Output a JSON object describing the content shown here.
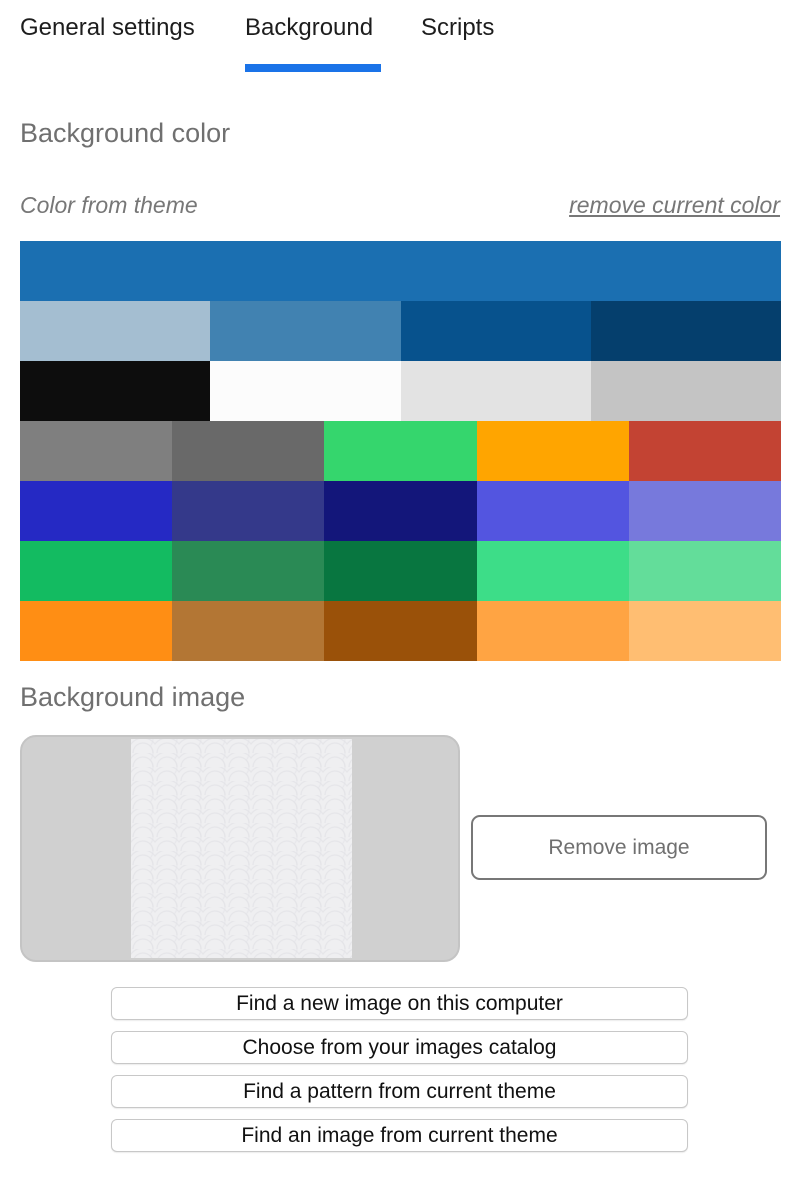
{
  "tabs": [
    {
      "label": "General settings"
    },
    {
      "label": "Background"
    },
    {
      "label": "Scripts"
    }
  ],
  "active_tab": "Background",
  "accent_color": "#1a73e8",
  "background_color": {
    "heading": "Background color",
    "theme_label": "Color from theme",
    "remove_link": "remove current color",
    "palette_rows": [
      [
        "#1b6fb1"
      ],
      [
        "#a4bed1",
        "#4182b1",
        "#07528d",
        "#053f6d"
      ],
      [
        "#0d0d0d",
        "#fcfcfc",
        "#e3e3e3",
        "#c4c4c4"
      ],
      [
        "#7f7f7f",
        "#696969",
        "#35d66d",
        "#ffa500",
        "#c34333"
      ],
      [
        "#2529c4",
        "#34398a",
        "#13167a",
        "#5355e0",
        "#7779dc"
      ],
      [
        "#13bb61",
        "#2a8a55",
        "#087640",
        "#3ddd88",
        "#63dd9a"
      ],
      [
        "#ff8e14",
        "#b37634",
        "#9a5109",
        "#ffa443",
        "#ffbe72"
      ]
    ]
  },
  "background_image": {
    "heading": "Background image",
    "remove_button": "Remove image",
    "actions": [
      "Find a new image on this computer",
      "Choose from your images catalog",
      "Find a pattern from current theme",
      "Find an image from current theme"
    ]
  }
}
